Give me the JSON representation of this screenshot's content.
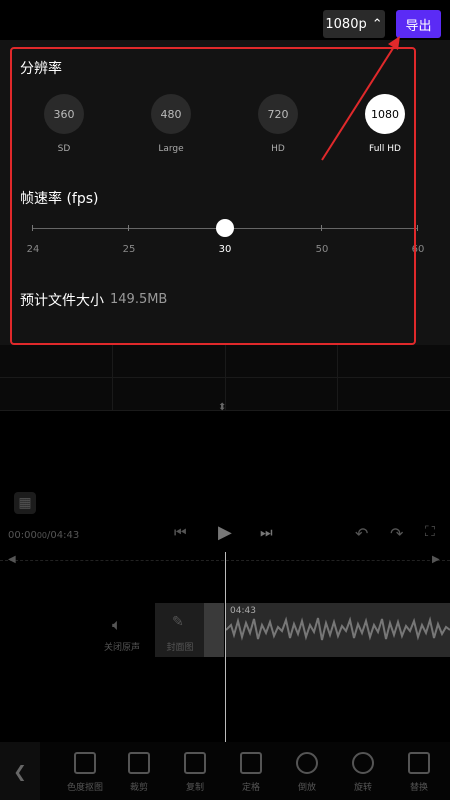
{
  "topbar": {
    "resolution_button": "1080p",
    "export_button": "导出"
  },
  "panel": {
    "resolution_title": "分辨率",
    "resolutions": [
      {
        "value": "360",
        "label": "SD",
        "selected": false
      },
      {
        "value": "480",
        "label": "Large",
        "selected": false
      },
      {
        "value": "720",
        "label": "HD",
        "selected": false
      },
      {
        "value": "1080",
        "label": "Full HD",
        "selected": true
      }
    ],
    "framerate_title": "帧速率 (fps)",
    "framerates": [
      "24",
      "25",
      "30",
      "50",
      "60"
    ],
    "selected_framerate": "30",
    "filesize_label": "预计文件大小",
    "filesize_value": "149.5MB"
  },
  "editor": {
    "time_current": "00:00",
    "time_separator": "00",
    "time_total": "/04:43",
    "clip_time": "04:43",
    "mute_label": "关闭原声",
    "cover_label": "封面图"
  },
  "toolbar": [
    {
      "label": "色度抠图",
      "icon": "chroma-key-icon"
    },
    {
      "label": "裁剪",
      "icon": "crop-icon"
    },
    {
      "label": "复制",
      "icon": "copy-icon"
    },
    {
      "label": "定格",
      "icon": "freeze-icon"
    },
    {
      "label": "倒放",
      "icon": "reverse-icon"
    },
    {
      "label": "旋转",
      "icon": "rotate-icon"
    },
    {
      "label": "替换",
      "icon": "replace-icon"
    }
  ]
}
